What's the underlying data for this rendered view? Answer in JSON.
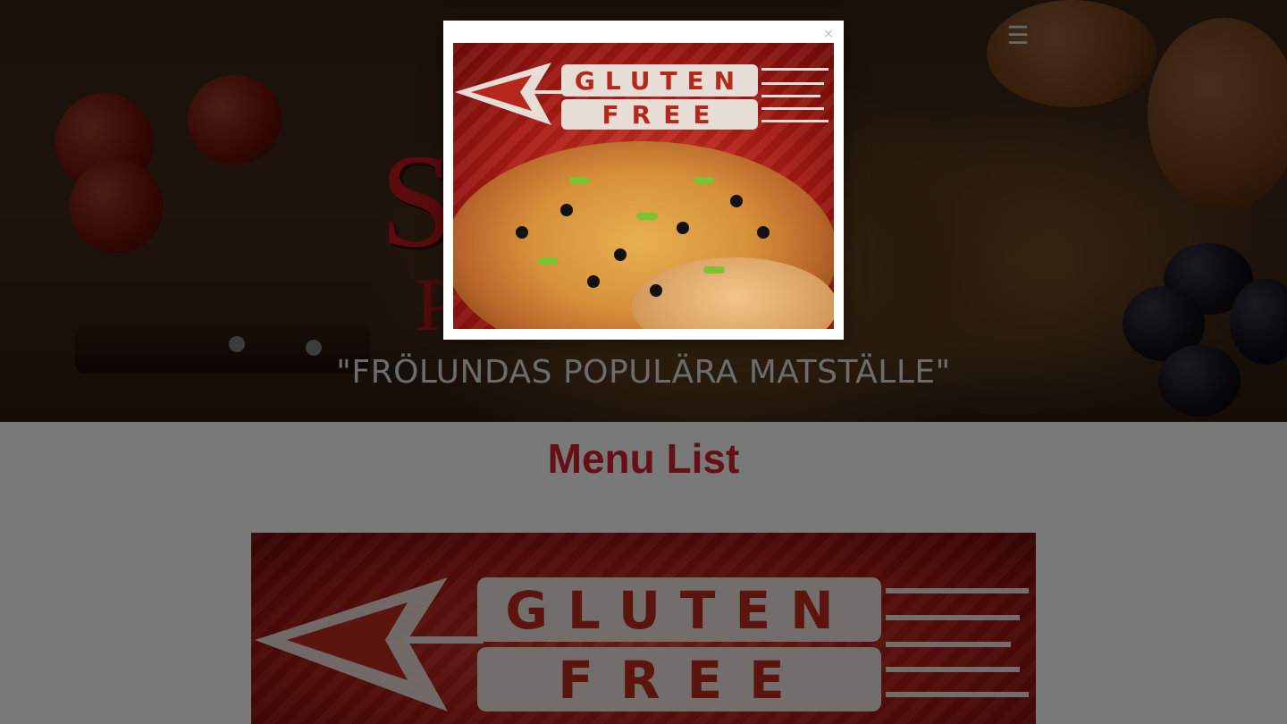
{
  "hero": {
    "brand_main": "S              E",
    "brand_sub": "P            B",
    "tagline": "\"FRÖLUNDAS POPULÄRA MATSTÄLLE\"",
    "menu_icon": "hamburger-menu-icon",
    "menu_glyph": "☰"
  },
  "content": {
    "title": "Menu List",
    "banner_text_top": "GLUTEN",
    "banner_text_bottom": "FREE"
  },
  "modal": {
    "close_glyph": "×",
    "image_text_top": "GLUTEN",
    "image_text_bottom": "FREE"
  },
  "colors": {
    "brand_red": "#b4161e",
    "title_red": "#c8202a",
    "overlay": "rgba(0,0,0,0.5)"
  }
}
